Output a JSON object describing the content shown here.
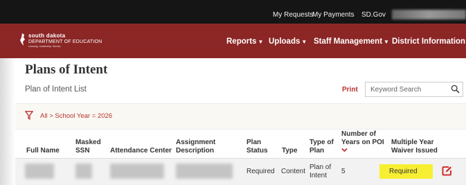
{
  "topbar": {
    "links": [
      "My Requests",
      "My Payments",
      "SD.Gov"
    ]
  },
  "logo": {
    "line1": "south dakota",
    "line2": "DEPARTMENT OF EDUCATION",
    "tagline": "Learning. Leadership. Service."
  },
  "nav": {
    "items": [
      "Reports",
      "Uploads",
      "Staff Management",
      "District Information"
    ]
  },
  "page": {
    "title": "Plans of Intent",
    "list_title": "Plan of Intent List",
    "print_label": "Print",
    "search_placeholder": "Keyword Search"
  },
  "filter": {
    "text": "All > School Year = 2026"
  },
  "table": {
    "headers": {
      "full_name": "Full Name",
      "masked_ssn_1": "Masked",
      "masked_ssn_2": "SSN",
      "attendance_center": "Attendance Center",
      "assignment_1": "Assignment",
      "assignment_2": "Description",
      "plan_status_1": "Plan",
      "plan_status_2": "Status",
      "type": "Type",
      "type_of_plan_1": "Type of",
      "type_of_plan_2": "Plan",
      "years_1": "Number of",
      "years_2": "Years on POI",
      "waiver_1": "Multiple Year",
      "waiver_2": "Waiver Issued"
    },
    "row": {
      "plan_status": "Required",
      "type": "Content",
      "type_of_plan_1": "Plan of",
      "type_of_plan_2": "Intent",
      "years": "5",
      "waiver": "Required"
    }
  },
  "colors": {
    "brand_red": "#8a2524",
    "accent_red": "#b8312f",
    "highlight_yellow": "#f7ef32",
    "topbar": "#151515"
  },
  "icons": {
    "filter": "funnel-icon",
    "search": "magnifier-icon",
    "edit": "edit-pencil-icon",
    "sort": "chevron-down-icon"
  }
}
